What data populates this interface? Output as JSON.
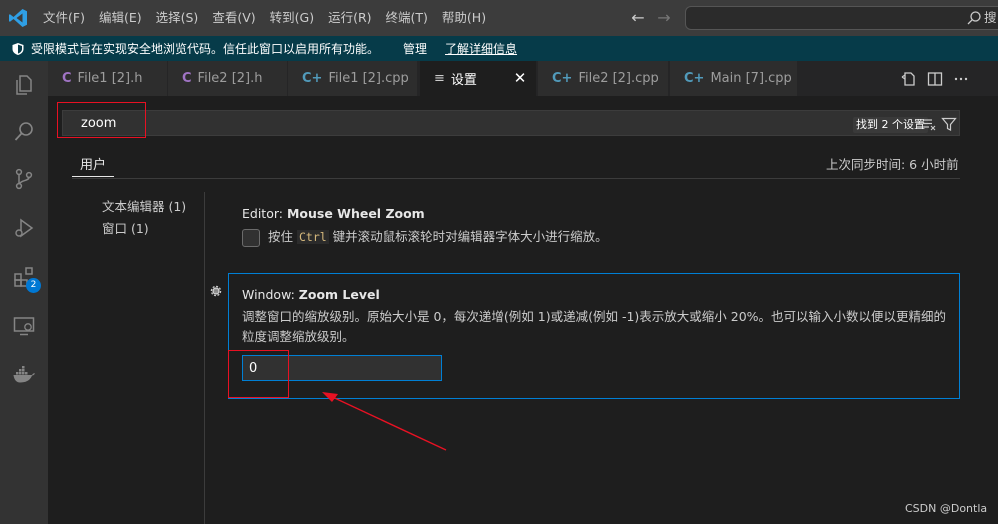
{
  "menu": [
    "文件(F)",
    "编辑(E)",
    "选择(S)",
    "查看(V)",
    "转到(G)",
    "运行(R)",
    "终端(T)",
    "帮助(H)"
  ],
  "command_center": {
    "text": "搜"
  },
  "banner": {
    "message": "受限模式旨在实现安全地浏览代码。信任此窗口以启用所有功能。",
    "manage": "管理",
    "learn_more": "了解详细信息"
  },
  "activity": {
    "extensions_badge": "2"
  },
  "tabs": [
    {
      "icon": "C",
      "label": "File1 [2].h",
      "kind": "h"
    },
    {
      "icon": "C",
      "label": "File2 [2].h",
      "kind": "h"
    },
    {
      "icon": "C+",
      "label": "File1 [2].cpp",
      "kind": "cpp"
    },
    {
      "icon": "≡",
      "label": "设置",
      "kind": "settings",
      "active": true
    },
    {
      "icon": "C+",
      "label": "File2 [2].cpp",
      "kind": "cpp"
    },
    {
      "icon": "C+",
      "label": "Main [7].cpp",
      "kind": "cpp"
    }
  ],
  "settings": {
    "search_value": "zoom",
    "result_count": "找到 2 个设置",
    "scope_tab": "用户",
    "sync_status": "上次同步时间: 6 小时前",
    "toc": [
      "文本编辑器 (1)",
      "窗口 (1)"
    ],
    "mouse_wheel_zoom": {
      "category": "Editor: ",
      "name": "Mouse Wheel Zoom",
      "desc_before": "按住 ",
      "desc_code": "Ctrl",
      "desc_after": " 键并滚动鼠标滚轮时对编辑器字体大小进行缩放。"
    },
    "zoom_level": {
      "category": "Window: ",
      "name": "Zoom Level",
      "description": "调整窗口的缩放级别。原始大小是 0，每次递增(例如 1)或递减(例如 -1)表示放大或缩小 20%。也可以输入小数以便以更精细的粒度调整缩放级别。",
      "value": "0"
    }
  },
  "watermark": "CSDN @Dontla",
  "colors": {
    "accent": "#007fd4",
    "banner": "#063b49",
    "annotation": "#e81123"
  }
}
